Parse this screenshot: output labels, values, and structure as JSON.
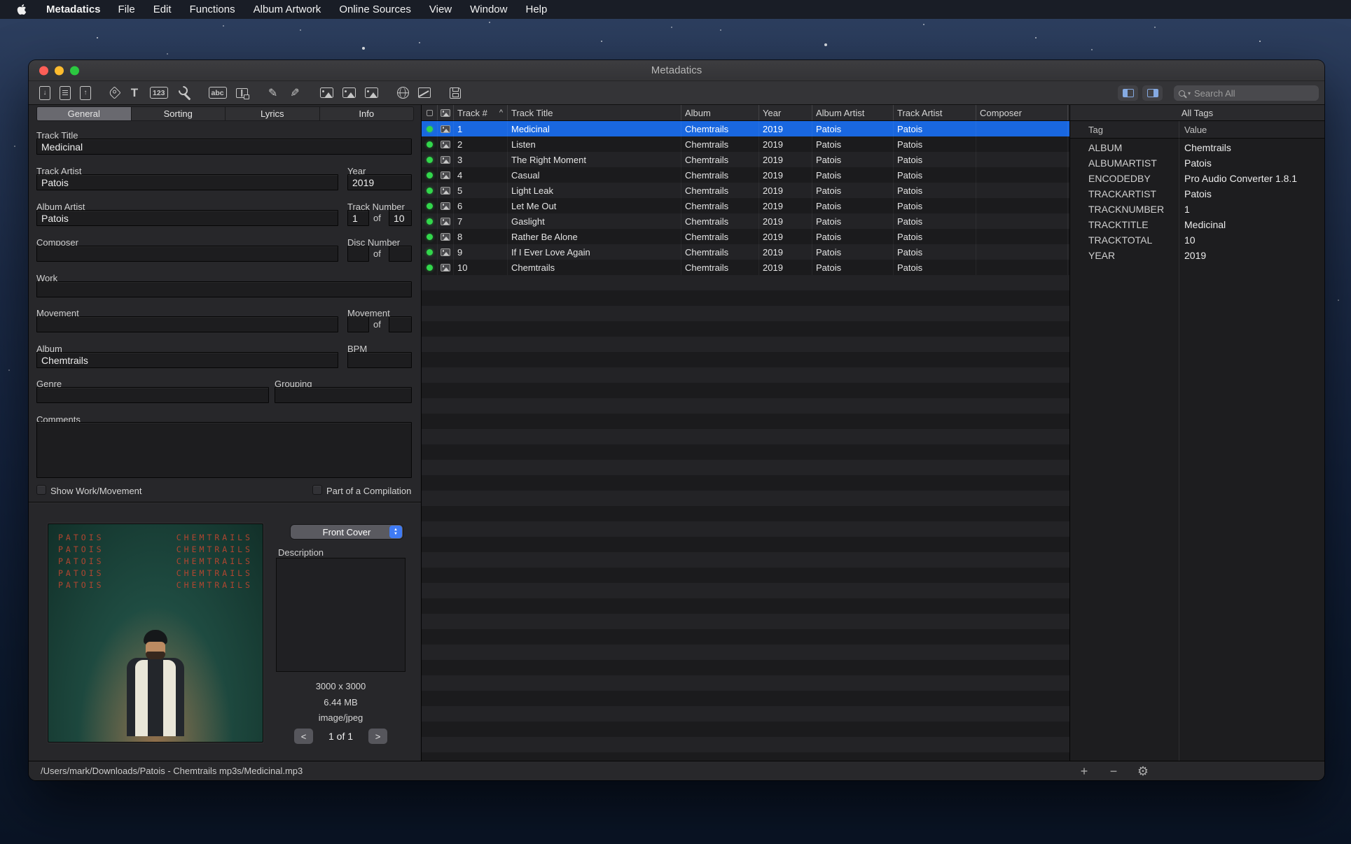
{
  "colors": {
    "selection": "#1967e0",
    "accent_blue": "#3f7bf5",
    "status_green": "#32d74b"
  },
  "menubar": {
    "app_name": "Metadatics",
    "items": [
      "File",
      "Edit",
      "Functions",
      "Album Artwork",
      "Online Sources",
      "View",
      "Window",
      "Help"
    ]
  },
  "window": {
    "title": "Metadatics"
  },
  "toolbar": {
    "groups": [
      [
        {
          "name": "open-files-icon",
          "kind": "t-doc",
          "glyph": "↓"
        },
        {
          "name": "open-folder-icon",
          "kind": "t-doc t-lines",
          "glyph": ""
        },
        {
          "name": "export-file-icon",
          "kind": "t-doc",
          "glyph": "↑"
        }
      ],
      [
        {
          "name": "remove-tags-icon",
          "kind": "t-tag",
          "glyph": ""
        },
        {
          "name": "case-conversion-icon",
          "kind": "t-big",
          "glyph": "T"
        },
        {
          "name": "track-numbering-icon",
          "kind": "t-box",
          "glyph": "123"
        },
        {
          "name": "utilities-wrench-icon",
          "kind": "t-wrench",
          "glyph": ""
        }
      ],
      [
        {
          "name": "spellcheck-icon",
          "kind": "t-box",
          "glyph": "abc"
        },
        {
          "name": "dictionary-lock-icon",
          "kind": "t-book",
          "glyph": ""
        }
      ],
      [
        {
          "name": "tags-from-filename-icon",
          "kind": "t-pen",
          "glyph": "✎"
        },
        {
          "name": "filename-from-tags-icon",
          "kind": "t-pen t-flip",
          "glyph": "✎"
        }
      ],
      [
        {
          "name": "artwork-add-icon",
          "kind": "t-img",
          "glyph": ""
        },
        {
          "name": "artwork-view-icon",
          "kind": "t-img",
          "glyph": ""
        },
        {
          "name": "artwork-export-icon",
          "kind": "t-img",
          "glyph": ""
        }
      ],
      [
        {
          "name": "online-sources-globe-icon",
          "kind": "t-globe",
          "glyph": ""
        },
        {
          "name": "audio-analysis-icon",
          "kind": "t-chart",
          "glyph": ""
        }
      ],
      [
        {
          "name": "save-icon",
          "kind": "t-save",
          "glyph": ""
        }
      ]
    ],
    "search": {
      "placeholder": "Search All",
      "value": ""
    }
  },
  "editor": {
    "tabs": [
      {
        "label": "General",
        "selected": true
      },
      {
        "label": "Sorting",
        "selected": false
      },
      {
        "label": "Lyrics",
        "selected": false
      },
      {
        "label": "Info",
        "selected": false
      }
    ],
    "fields": {
      "track_title": {
        "label": "Track Title",
        "value": "Medicinal"
      },
      "track_artist": {
        "label": "Track Artist",
        "value": "Patois"
      },
      "year": {
        "label": "Year",
        "value": "2019"
      },
      "album_artist": {
        "label": "Album Artist",
        "value": "Patois"
      },
      "track_number": {
        "label": "Track Number",
        "value": "1",
        "of_label": "of",
        "total": "10"
      },
      "composer": {
        "label": "Composer",
        "value": ""
      },
      "disc_number": {
        "label": "Disc Number",
        "value": "",
        "of_label": "of",
        "total": ""
      },
      "work": {
        "label": "Work",
        "value": ""
      },
      "movement": {
        "label": "Movement",
        "value": ""
      },
      "movement_number": {
        "label": "Movement",
        "value": "",
        "of_label": "of",
        "total": ""
      },
      "album": {
        "label": "Album",
        "value": "Chemtrails"
      },
      "bpm": {
        "label": "BPM",
        "value": ""
      },
      "genre": {
        "label": "Genre",
        "value": ""
      },
      "grouping": {
        "label": "Grouping",
        "value": ""
      },
      "comments": {
        "label": "Comments",
        "value": ""
      }
    },
    "checkboxes": [
      {
        "label": "Show Work/Movement",
        "checked": false
      },
      {
        "label": "Part of a Compilation",
        "checked": false
      }
    ]
  },
  "artwork": {
    "cover_lines": [
      {
        "left": "PATOIS",
        "right": "CHEMTRAILS"
      },
      {
        "left": "PATOIS",
        "right": "CHEMTRAILS"
      },
      {
        "left": "PATOIS",
        "right": "CHEMTRAILS"
      },
      {
        "left": "PATOIS",
        "right": "CHEMTRAILS"
      },
      {
        "left": "PATOIS",
        "right": "CHEMTRAILS"
      }
    ],
    "type_selector": "Front Cover",
    "description_label": "Description",
    "dimensions": "3000 x 3000",
    "file_size": "6.44 MB",
    "mime_type": "image/jpeg",
    "prev_label": "<",
    "page_indicator": "1 of 1",
    "next_label": ">"
  },
  "tracklist": {
    "sort_indicator": "^",
    "columns": [
      "Track #",
      "Track Title",
      "Album",
      "Year",
      "Album Artist",
      "Track Artist",
      "Composer"
    ],
    "selected_index": 0,
    "rows": [
      {
        "num": "1",
        "title": "Medicinal",
        "album": "Chemtrails",
        "year": "2019",
        "album_artist": "Patois",
        "track_artist": "Patois",
        "composer": ""
      },
      {
        "num": "2",
        "title": "Listen",
        "album": "Chemtrails",
        "year": "2019",
        "album_artist": "Patois",
        "track_artist": "Patois",
        "composer": ""
      },
      {
        "num": "3",
        "title": "The Right Moment",
        "album": "Chemtrails",
        "year": "2019",
        "album_artist": "Patois",
        "track_artist": "Patois",
        "composer": ""
      },
      {
        "num": "4",
        "title": "Casual",
        "album": "Chemtrails",
        "year": "2019",
        "album_artist": "Patois",
        "track_artist": "Patois",
        "composer": ""
      },
      {
        "num": "5",
        "title": "Light Leak",
        "album": "Chemtrails",
        "year": "2019",
        "album_artist": "Patois",
        "track_artist": "Patois",
        "composer": ""
      },
      {
        "num": "6",
        "title": "Let Me Out",
        "album": "Chemtrails",
        "year": "2019",
        "album_artist": "Patois",
        "track_artist": "Patois",
        "composer": ""
      },
      {
        "num": "7",
        "title": "Gaslight",
        "album": "Chemtrails",
        "year": "2019",
        "album_artist": "Patois",
        "track_artist": "Patois",
        "composer": ""
      },
      {
        "num": "8",
        "title": "Rather Be Alone",
        "album": "Chemtrails",
        "year": "2019",
        "album_artist": "Patois",
        "track_artist": "Patois",
        "composer": ""
      },
      {
        "num": "9",
        "title": "If I Ever Love Again",
        "album": "Chemtrails",
        "year": "2019",
        "album_artist": "Patois",
        "track_artist": "Patois",
        "composer": ""
      },
      {
        "num": "10",
        "title": "Chemtrails",
        "album": "Chemtrails",
        "year": "2019",
        "album_artist": "Patois",
        "track_artist": "Patois",
        "composer": ""
      }
    ]
  },
  "tags_panel": {
    "title": "All Tags",
    "tag_column": "Tag",
    "value_column": "Value",
    "rows": [
      {
        "tag": "ALBUM",
        "value": "Chemtrails"
      },
      {
        "tag": "ALBUMARTIST",
        "value": "Patois"
      },
      {
        "tag": "ENCODEDBY",
        "value": "Pro Audio Converter 1.8.1"
      },
      {
        "tag": "TRACKARTIST",
        "value": "Patois"
      },
      {
        "tag": "TRACKNUMBER",
        "value": "1"
      },
      {
        "tag": "TRACKTITLE",
        "value": "Medicinal"
      },
      {
        "tag": "TRACKTOTAL",
        "value": "10"
      },
      {
        "tag": "YEAR",
        "value": "2019"
      }
    ]
  },
  "statusbar": {
    "path": "/Users/mark/Downloads/Patois - Chemtrails mp3s/Medicinal.mp3"
  }
}
